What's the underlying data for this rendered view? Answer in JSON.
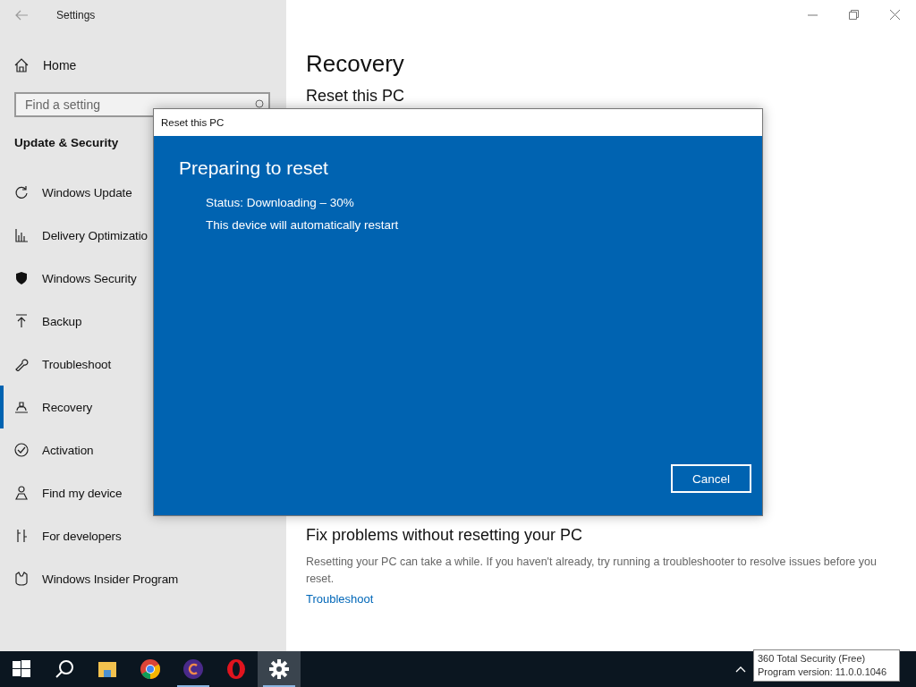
{
  "window": {
    "title": "Settings"
  },
  "sidebar": {
    "home": "Home",
    "search": {
      "placeholder": "Find a setting"
    },
    "section": "Update & Security",
    "items": [
      {
        "label": "Windows Update",
        "selected": false
      },
      {
        "label": "Delivery Optimizatio",
        "selected": false
      },
      {
        "label": "Windows Security",
        "selected": false
      },
      {
        "label": "Backup",
        "selected": false
      },
      {
        "label": "Troubleshoot",
        "selected": false
      },
      {
        "label": "Recovery",
        "selected": true
      },
      {
        "label": "Activation",
        "selected": false
      },
      {
        "label": "Find my device",
        "selected": false
      },
      {
        "label": "For developers",
        "selected": false
      },
      {
        "label": "Windows Insider Program",
        "selected": false
      }
    ]
  },
  "content": {
    "title": "Recovery",
    "reset_heading": "Reset this PC",
    "fix": {
      "heading": "Fix problems without resetting your PC",
      "text": "Resetting your PC can take a while. If you haven't already, try running a troubleshooter to resolve issues before you reset.",
      "link": "Troubleshoot"
    }
  },
  "dialog": {
    "title": "Reset this PC",
    "heading": "Preparing to reset",
    "lines": [
      "Status: Downloading – 30%",
      "This device will automatically restart"
    ],
    "button": "Cancel"
  },
  "taskbar": {
    "items": [
      {
        "selected": false,
        "running": false
      },
      {
        "selected": false,
        "running": false
      },
      {
        "selected": false,
        "running": false
      },
      {
        "selected": false,
        "running": false
      },
      {
        "selected": false,
        "running": true
      },
      {
        "selected": false,
        "running": false
      },
      {
        "selected": true,
        "running": true
      }
    ],
    "tooltip": [
      "360 Total Security (Free)",
      "Program version: 11.0.0.1046"
    ]
  }
}
